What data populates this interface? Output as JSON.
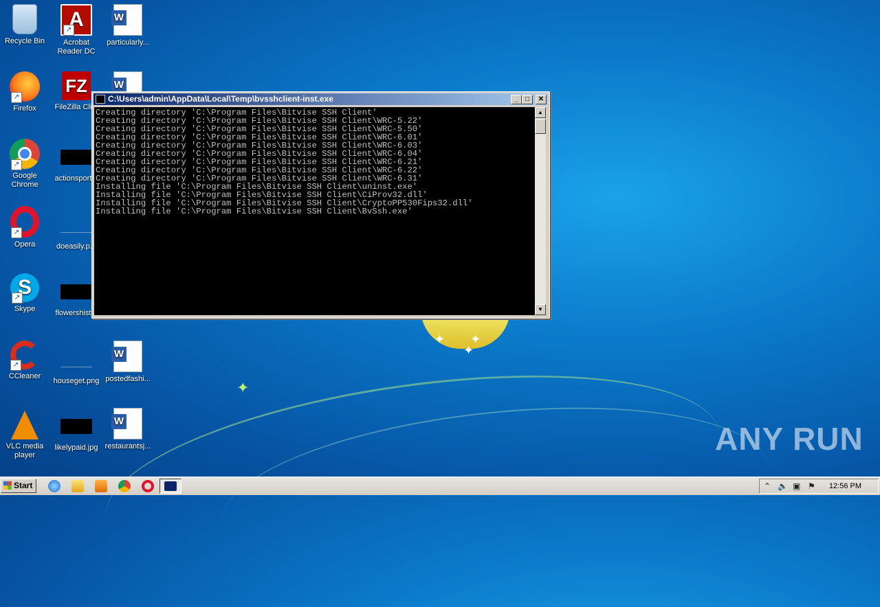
{
  "desktop": {
    "icons": [
      {
        "label": "Recycle Bin"
      },
      {
        "label": "Acrobat Reader DC"
      },
      {
        "label": "particularly..."
      },
      {
        "label": "Firefox"
      },
      {
        "label": "FileZilla Cli..."
      },
      {
        "label": ""
      },
      {
        "label": "Google Chrome"
      },
      {
        "label": "actionsport..."
      },
      {
        "label": "Opera"
      },
      {
        "label": "doeasily.p..."
      },
      {
        "label": "Skype"
      },
      {
        "label": "flowershist..."
      },
      {
        "label": "CCleaner"
      },
      {
        "label": "houseget.png"
      },
      {
        "label": "postedfashi..."
      },
      {
        "label": "VLC media player"
      },
      {
        "label": "likelypaid.jpg"
      },
      {
        "label": "restaurantsj..."
      }
    ],
    "watermark": "ANY RUN"
  },
  "console_window": {
    "title": "C:\\Users\\admin\\AppData\\Local\\Temp\\bvsshclient-inst.exe",
    "buttons": {
      "minimize": "_",
      "maximize": "□",
      "close": "✕"
    },
    "lines": [
      "Creating directory 'C:\\Program Files\\Bitvise SSH Client'",
      "Creating directory 'C:\\Program Files\\Bitvise SSH Client\\WRC-5.22'",
      "Creating directory 'C:\\Program Files\\Bitvise SSH Client\\WRC-5.50'",
      "Creating directory 'C:\\Program Files\\Bitvise SSH Client\\WRC-6.01'",
      "Creating directory 'C:\\Program Files\\Bitvise SSH Client\\WRC-6.03'",
      "Creating directory 'C:\\Program Files\\Bitvise SSH Client\\WRC-6.04'",
      "Creating directory 'C:\\Program Files\\Bitvise SSH Client\\WRC-6.21'",
      "Creating directory 'C:\\Program Files\\Bitvise SSH Client\\WRC-6.22'",
      "Creating directory 'C:\\Program Files\\Bitvise SSH Client\\WRC-6.31'",
      "Installing file 'C:\\Program Files\\Bitvise SSH Client\\uninst.exe'",
      "Installing file 'C:\\Program Files\\Bitvise SSH Client\\CiProv32.dll'",
      "Installing file 'C:\\Program Files\\Bitvise SSH Client\\CryptoPP530Fips32.dll'",
      "Installing file 'C:\\Program Files\\Bitvise SSH Client\\BvSsh.exe'"
    ]
  },
  "taskbar": {
    "start_label": "Start",
    "quick_launch": [
      "internet-explorer-icon",
      "explorer-folder-icon",
      "media-player-icon",
      "chrome-icon",
      "opera-icon"
    ],
    "clock": "12:56 PM"
  }
}
